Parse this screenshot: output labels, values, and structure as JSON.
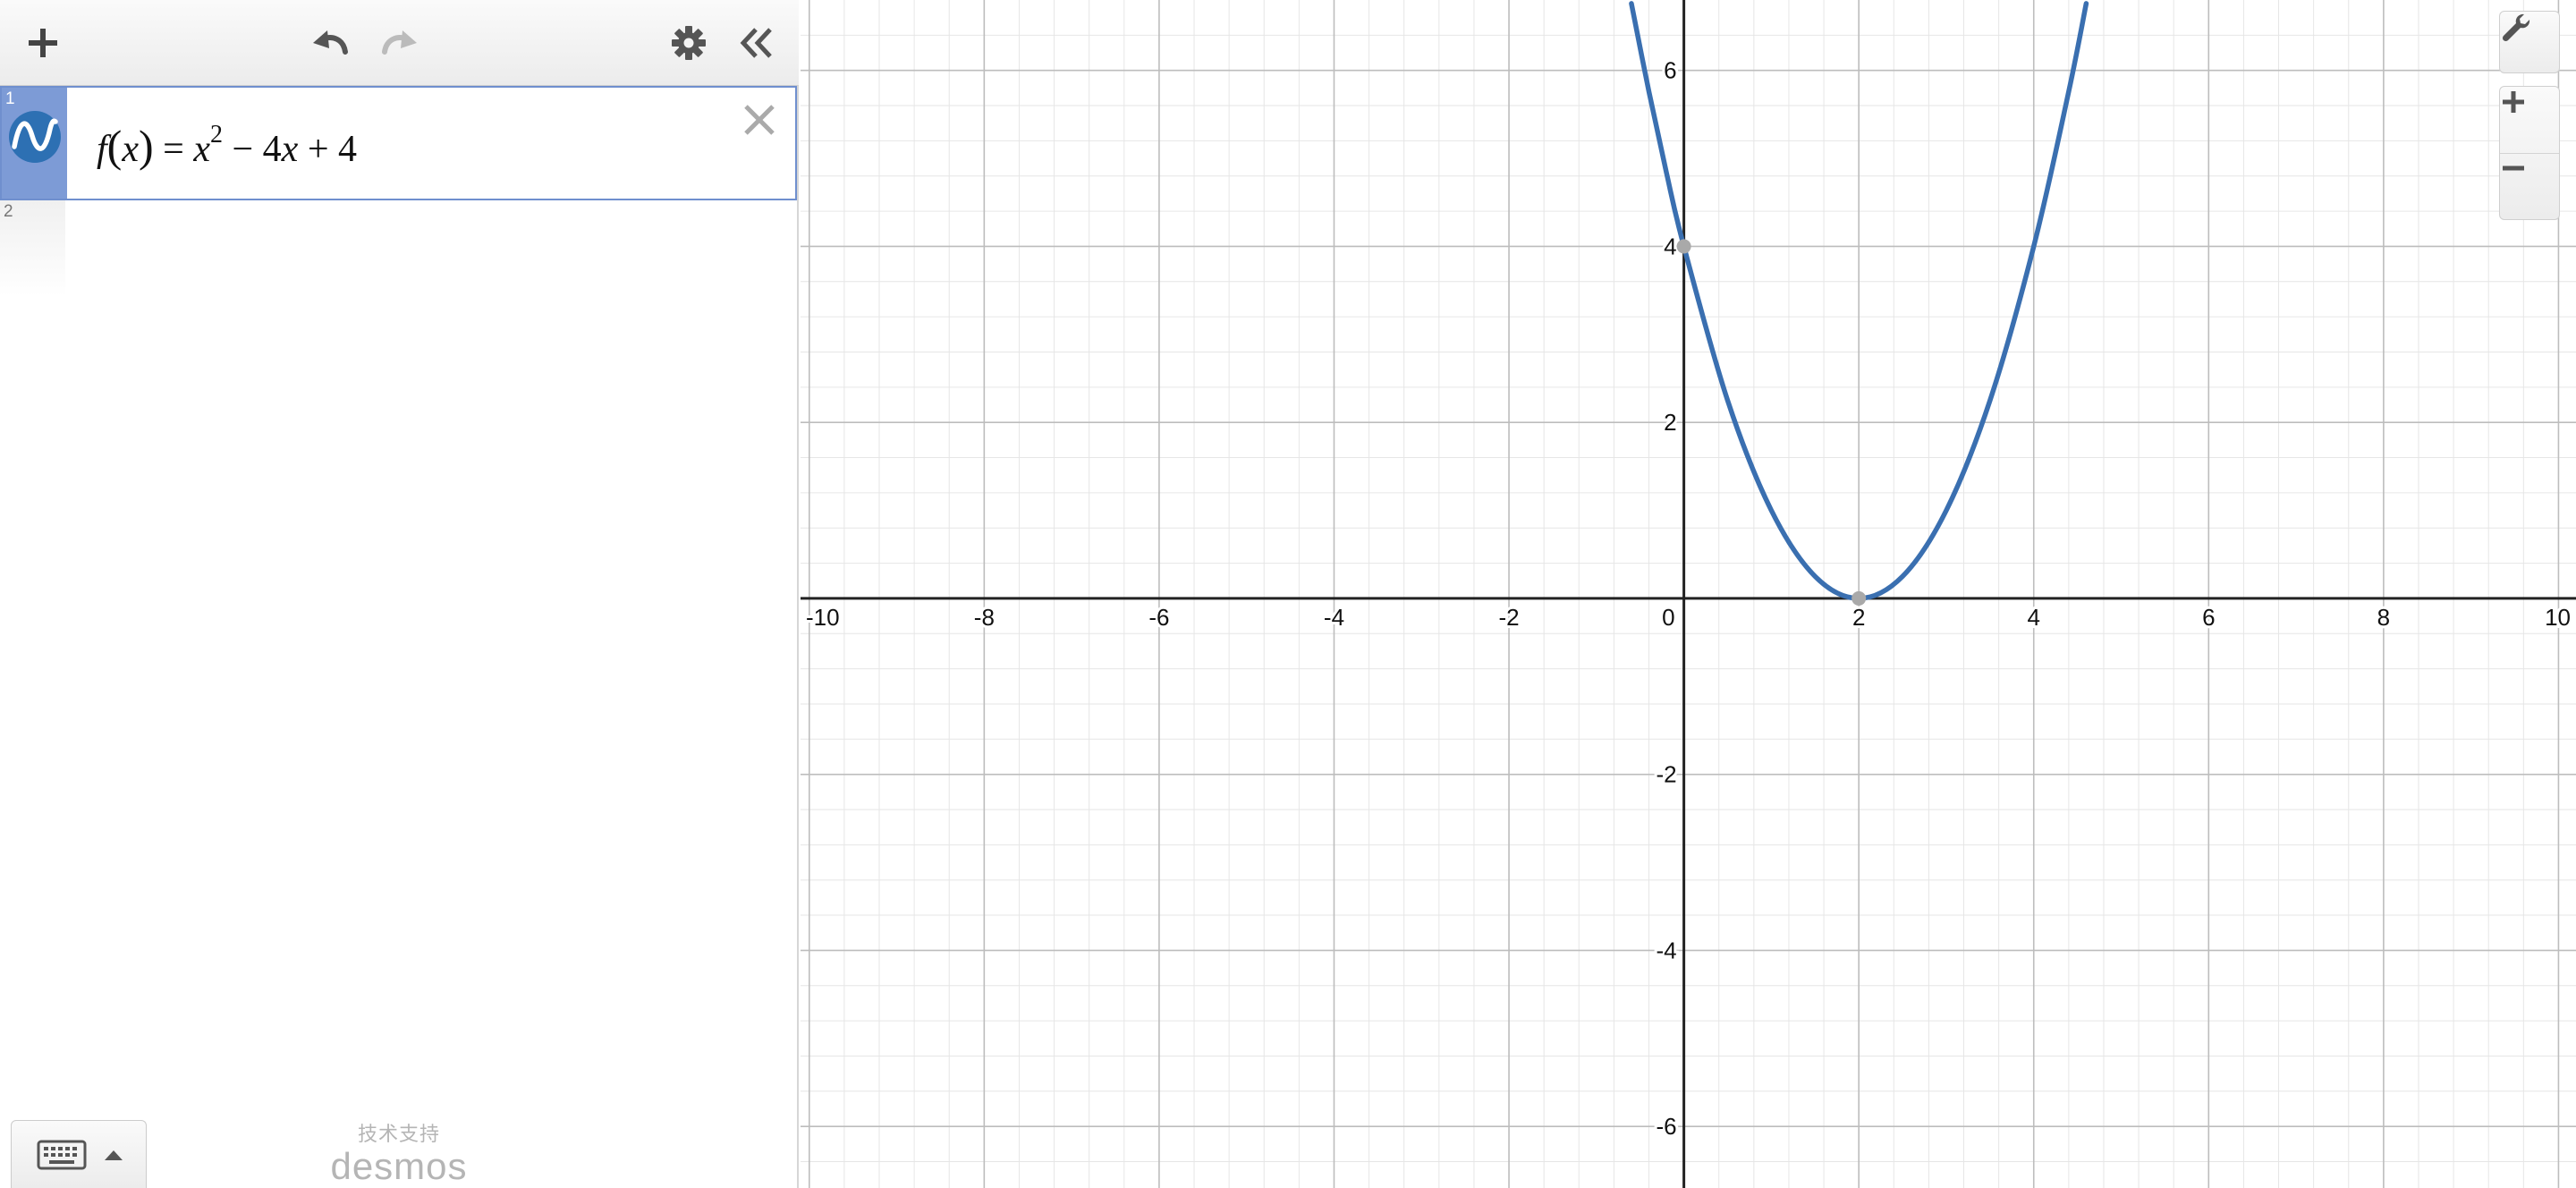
{
  "toolbar": {
    "add_icon": "plus-icon",
    "undo_icon": "undo-icon",
    "redo_icon": "redo-icon",
    "settings_icon": "gear-icon",
    "collapse_icon": "double-chevron-left-icon"
  },
  "expressions": [
    {
      "index": "1",
      "latex": "f(x) = x^2 - 4x + 4",
      "parts": {
        "fname": "f",
        "open_paren": "(",
        "var": "x",
        "close_paren": ")",
        "equals": "=",
        "base": "x",
        "exponent": "2",
        "minus": "−",
        "coef": "4",
        "var2": "x",
        "plus": "+",
        "constant": "4"
      },
      "color": "#2d70b3",
      "icon": "graph-wave-icon",
      "delete_icon": "close-icon"
    },
    {
      "index": "2",
      "latex": ""
    }
  ],
  "keypad": {
    "icon": "keyboard-icon",
    "caret_icon": "caret-up-icon"
  },
  "branding": {
    "powered_by": "技术支持",
    "brand": "desmos"
  },
  "graph_controls": {
    "settings_icon": "wrench-icon",
    "zoom_in_icon": "plus-icon",
    "zoom_out_icon": "minus-icon"
  },
  "graph": {
    "x_range": [
      -10.1,
      10.2
    ],
    "y_range": [
      -6.7,
      6.8
    ],
    "major_step": 2,
    "minor_step": 0.4,
    "x_tick_labels": [
      "-10",
      "-8",
      "-6",
      "-4",
      "-2",
      "0",
      "2",
      "4",
      "6",
      "8",
      "10"
    ],
    "y_tick_labels": [
      "6",
      "4",
      "2",
      "-2",
      "-4",
      "-6"
    ],
    "curve_color": "#3a6fb0",
    "points_of_interest": [
      {
        "x": 0,
        "y": 4
      },
      {
        "x": 2,
        "y": 0
      }
    ]
  },
  "chart_data": {
    "type": "line",
    "title": "",
    "xlabel": "",
    "ylabel": "",
    "xlim": [
      -10.1,
      10.2
    ],
    "ylim": [
      -6.7,
      6.8
    ],
    "grid": true,
    "series": [
      {
        "name": "f(x) = x^2 - 4x + 4",
        "x": [
          -0.6,
          -0.4,
          -0.2,
          0,
          0.5,
          1,
          1.5,
          2,
          2.5,
          3,
          3.5,
          4,
          4.4,
          4.6
        ],
        "y": [
          6.76,
          5.76,
          4.84,
          4,
          2.25,
          1,
          0.25,
          0,
          0.25,
          1,
          2.25,
          4,
          5.76,
          6.76
        ]
      }
    ]
  }
}
